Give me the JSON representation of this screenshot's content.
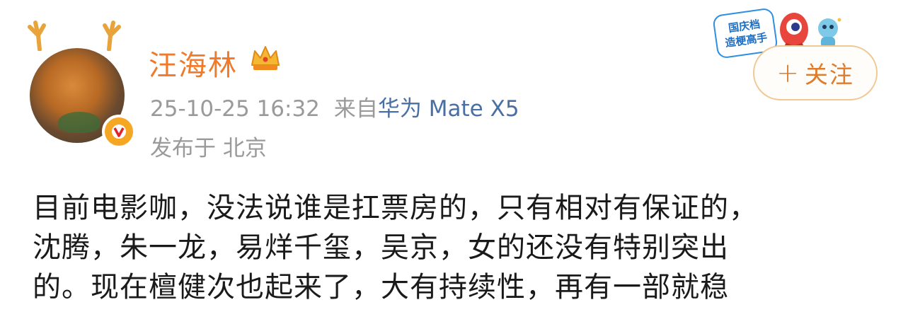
{
  "user": {
    "name": "汪海林",
    "verified": true
  },
  "post": {
    "timestamp": "25-10-25 16:32",
    "source_prefix": "来自",
    "source_device": "华为 Mate X5",
    "location": "发布于 北京",
    "body_lines": [
      "目前电影咖，没法说谁是扛票房的，只有相对有保证的，",
      "沈腾，朱一龙，易烊千玺，吴京，女的还没有特别突出",
      "的。现在檀健次也起来了，大有持续性，再有一部就稳"
    ]
  },
  "promo": {
    "line1": "国庆档",
    "line2": "造梗高手"
  },
  "follow_button": {
    "plus": "+",
    "label": "关注"
  },
  "colors": {
    "name": "#f07a2b",
    "meta": "#9a9a9a",
    "device_link": "#4a6fa5",
    "follow_border": "#f0c894",
    "follow_text": "#e07b2a"
  },
  "icons": {
    "crown": "crown-icon",
    "verified": "verified-v-icon",
    "antlers": "antler-icon"
  }
}
